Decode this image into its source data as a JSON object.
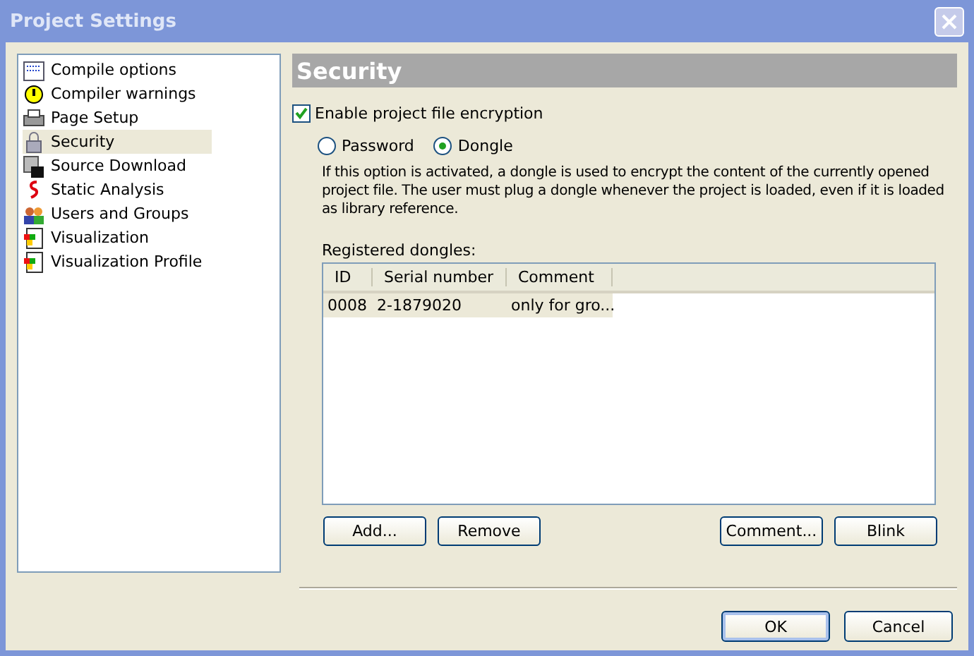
{
  "window": {
    "title": "Project Settings"
  },
  "sidebar": {
    "items": [
      {
        "label": "Compile options",
        "selected": false
      },
      {
        "label": "Compiler warnings",
        "selected": false
      },
      {
        "label": "Page Setup",
        "selected": false
      },
      {
        "label": "Security",
        "selected": true
      },
      {
        "label": "Source Download",
        "selected": false
      },
      {
        "label": "Static Analysis",
        "selected": false
      },
      {
        "label": "Users and Groups",
        "selected": false
      },
      {
        "label": "Visualization",
        "selected": false
      },
      {
        "label": "Visualization Profile",
        "selected": false
      }
    ]
  },
  "panel": {
    "title": "Security",
    "encryption": {
      "label": "Enable project file encryption",
      "checked": true
    },
    "modes": [
      {
        "label": "Password",
        "selected": false
      },
      {
        "label": "Dongle",
        "selected": true
      }
    ],
    "description": "If this option is activated, a dongle is used to encrypt the content of the currently opened project file. The user must plug a dongle whenever the project is loaded, even if it is loaded as library reference.",
    "table_label": "Registered dongles:",
    "table": {
      "columns": [
        "ID",
        "Serial number",
        "Comment"
      ],
      "rows": [
        {
          "cells": [
            "0008",
            "2-1879020",
            "only for gro..."
          ],
          "selected": true
        }
      ]
    },
    "left_buttons": [
      "Add...",
      "Remove"
    ],
    "right_buttons": [
      "Comment...",
      "Blink"
    ]
  },
  "buttons": [
    {
      "label": "OK",
      "default": true
    },
    {
      "label": "Cancel",
      "default": false
    }
  ]
}
